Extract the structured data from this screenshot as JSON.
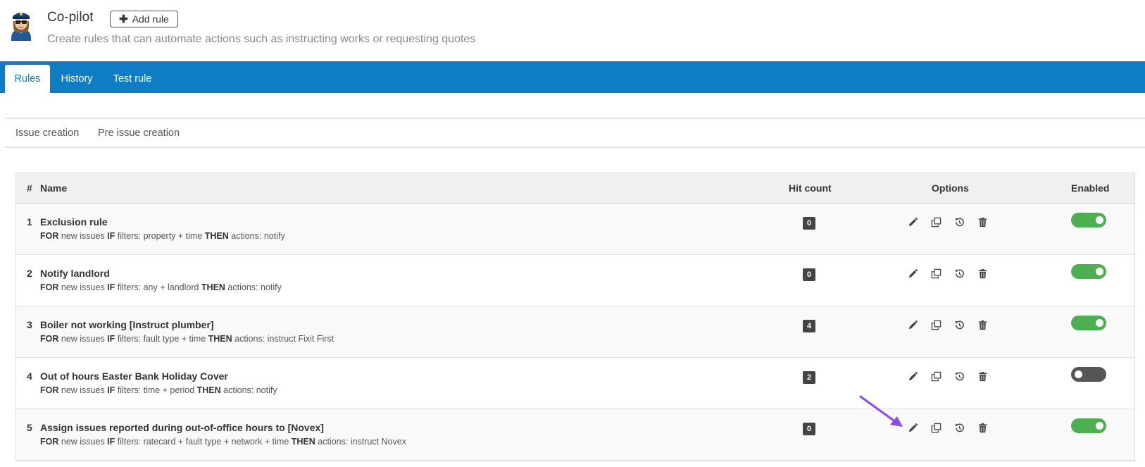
{
  "header": {
    "title": "Co-pilot",
    "add_rule_label": "Add rule",
    "subtitle": "Create rules that can automate actions such as instructing works or requesting quotes"
  },
  "tabs": [
    "Rules",
    "History",
    "Test rule"
  ],
  "subtabs": [
    "Issue creation",
    "Pre issue creation"
  ],
  "table": {
    "headers": {
      "num": "#",
      "name": "Name",
      "hit": "Hit count",
      "options": "Options",
      "enabled": "Enabled"
    },
    "rows": [
      {
        "num": "1",
        "name": "Exclusion rule",
        "for": "FOR",
        "for_text": " new issues ",
        "if": "IF",
        "if_text": " filters: property + time ",
        "then": "THEN",
        "then_text": " actions: notify",
        "hits": "0",
        "enabled": true
      },
      {
        "num": "2",
        "name": "Notify landlord",
        "for": "FOR",
        "for_text": " new issues ",
        "if": "IF",
        "if_text": " filters: any + landlord ",
        "then": "THEN",
        "then_text": " actions: notify",
        "hits": "0",
        "enabled": true
      },
      {
        "num": "3",
        "name": "Boiler not working [Instruct plumber]",
        "for": "FOR",
        "for_text": " new issues ",
        "if": "IF",
        "if_text": " filters: fault type + time ",
        "then": "THEN",
        "then_text": " actions: instruct Fixit First",
        "hits": "4",
        "enabled": true
      },
      {
        "num": "4",
        "name": "Out of hours Easter Bank Holiday Cover",
        "for": "FOR",
        "for_text": " new issues ",
        "if": "IF",
        "if_text": " filters: time + period ",
        "then": "THEN",
        "then_text": " actions: notify",
        "hits": "2",
        "enabled": false
      },
      {
        "num": "5",
        "name": "Assign issues reported during out-of-office hours to [Novex]",
        "for": "FOR",
        "for_text": " new issues ",
        "if": "IF",
        "if_text": " filters: ratecard + fault type + network + time ",
        "then": "THEN",
        "then_text": " actions: instruct Novex",
        "hits": "0",
        "enabled": true
      }
    ]
  },
  "icons": {
    "edit": "pencil-icon",
    "copy": "copy-icon",
    "history": "history-icon",
    "delete": "trash-icon"
  },
  "colors": {
    "tabbar": "#0e7dc4",
    "toggle_on": "#4caf50",
    "toggle_off": "#555555",
    "annotation_arrow": "#8a4de8"
  }
}
